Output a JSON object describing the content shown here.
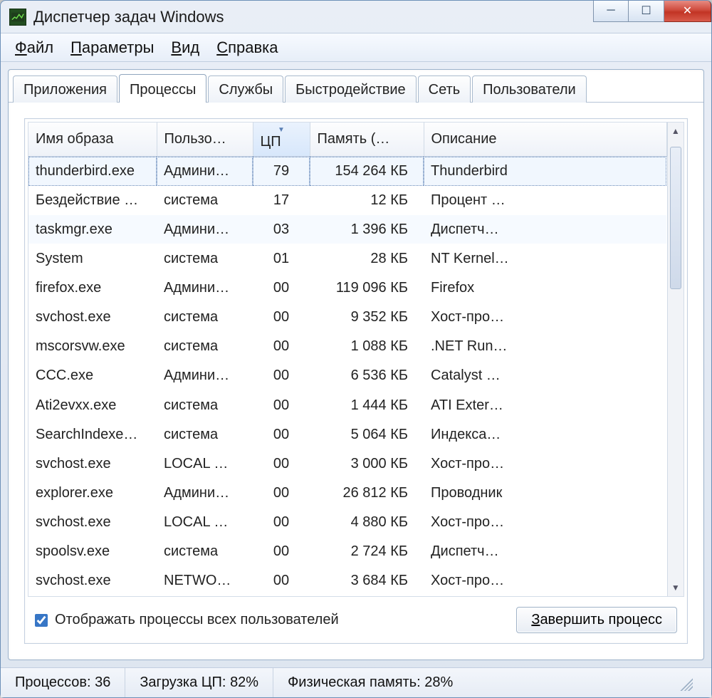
{
  "window": {
    "title": "Диспетчер задач Windows"
  },
  "window_buttons": {
    "minimize": "─",
    "maximize": "☐",
    "close": "✕"
  },
  "menu": {
    "file": {
      "hot": "Ф",
      "rest": "айл"
    },
    "options": {
      "hot": "П",
      "rest": "араметры"
    },
    "view": {
      "hot": "В",
      "rest": "ид"
    },
    "help": {
      "hot": "С",
      "rest": "правка"
    }
  },
  "tabs": {
    "applications": "Приложения",
    "processes": "Процессы",
    "services": "Службы",
    "performance": "Быстродействие",
    "networking": "Сеть",
    "users": "Пользователи",
    "active": "processes"
  },
  "columns": {
    "name": "Имя образа",
    "user": "Пользо…",
    "cpu": "ЦП",
    "mem": "Память (…",
    "desc": "Описание",
    "sorted": "cpu"
  },
  "rows": [
    {
      "name": "thunderbird.exe",
      "user": "Админи…",
      "cpu": "79",
      "mem": "154 264 КБ",
      "desc": "Thunderbird",
      "selected": true
    },
    {
      "name": "Бездействие …",
      "user": "система",
      "cpu": "17",
      "mem": "12 КБ",
      "desc": "Процент …"
    },
    {
      "name": "taskmgr.exe",
      "user": "Админи…",
      "cpu": "03",
      "mem": "1 396 КБ",
      "desc": "Диспетч…",
      "hover": true
    },
    {
      "name": "System",
      "user": "система",
      "cpu": "01",
      "mem": "28 КБ",
      "desc": "NT Kernel…"
    },
    {
      "name": "firefox.exe",
      "user": "Админи…",
      "cpu": "00",
      "mem": "119 096 КБ",
      "desc": "Firefox"
    },
    {
      "name": "svchost.exe",
      "user": "система",
      "cpu": "00",
      "mem": "9 352 КБ",
      "desc": "Хост-про…"
    },
    {
      "name": "mscorsvw.exe",
      "user": "система",
      "cpu": "00",
      "mem": "1 088 КБ",
      "desc": ".NET Run…"
    },
    {
      "name": "CCC.exe",
      "user": "Админи…",
      "cpu": "00",
      "mem": "6 536 КБ",
      "desc": "Catalyst …"
    },
    {
      "name": "Ati2evxx.exe",
      "user": "система",
      "cpu": "00",
      "mem": "1 444 КБ",
      "desc": "ATI Exter…"
    },
    {
      "name": "SearchIndexe…",
      "user": "система",
      "cpu": "00",
      "mem": "5 064 КБ",
      "desc": "Индекса…"
    },
    {
      "name": "svchost.exe",
      "user": "LOCAL …",
      "cpu": "00",
      "mem": "3 000 КБ",
      "desc": "Хост-про…"
    },
    {
      "name": "explorer.exe",
      "user": "Админи…",
      "cpu": "00",
      "mem": "26 812 КБ",
      "desc": "Проводник"
    },
    {
      "name": "svchost.exe",
      "user": "LOCAL …",
      "cpu": "00",
      "mem": "4 880 КБ",
      "desc": "Хост-про…"
    },
    {
      "name": "spoolsv.exe",
      "user": "система",
      "cpu": "00",
      "mem": "2 724 КБ",
      "desc": "Диспетч…"
    },
    {
      "name": "svchost.exe",
      "user": "NETWO…",
      "cpu": "00",
      "mem": "3 684 КБ",
      "desc": "Хост-про…"
    }
  ],
  "footer": {
    "show_all_label": "Отображать процессы всех пользователей",
    "show_all_checked": true,
    "end_process_hot": "З",
    "end_process_rest": "авершить процесс"
  },
  "status": {
    "processes_label": "Процессов:",
    "processes_value": "36",
    "cpu_label": "Загрузка ЦП:",
    "cpu_value": "82%",
    "mem_label": "Физическая память:",
    "mem_value": "28%"
  }
}
